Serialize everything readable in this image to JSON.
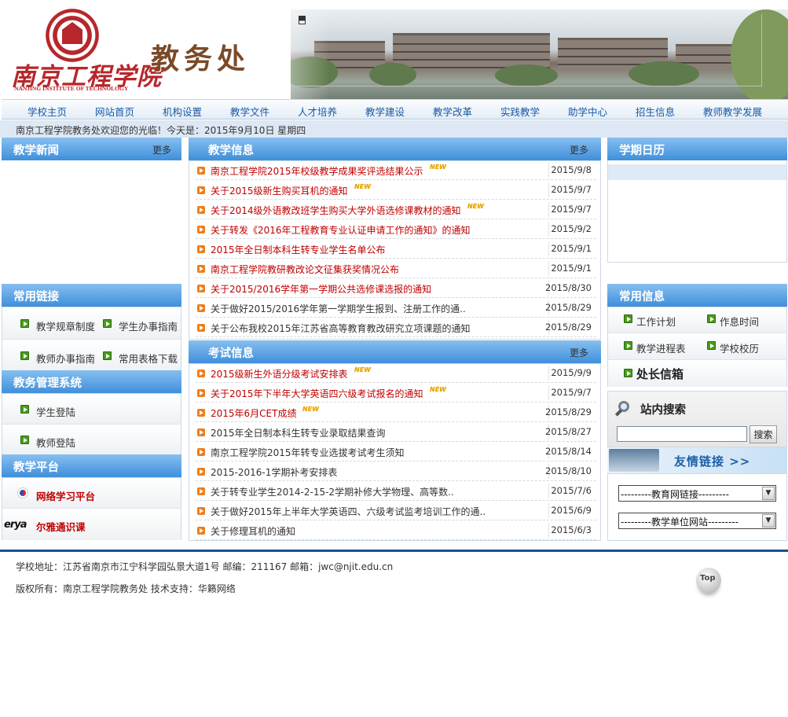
{
  "header": {
    "logo_cn": "南京工程学院",
    "logo_en": "NANJING INSTITUTE OF TECHNOLOGY",
    "banner_title": "教务处"
  },
  "nav": {
    "items": [
      "学校主页",
      "网站首页",
      "机构设置",
      "教学文件",
      "人才培养",
      "教学建设",
      "教学改革",
      "实践教学",
      "助学中心",
      "招生信息",
      "教师教学发展"
    ]
  },
  "welcome": "南京工程学院教务处欢迎您的光临！今天是：2015年9月10日 星期四",
  "left": {
    "news_title": "教学新闻",
    "news_more": "更多",
    "links_title": "常用链接",
    "links": [
      "教学规章制度",
      "学生办事指南",
      "教师办事指南",
      "常用表格下载"
    ],
    "system_title": "教务管理系统",
    "system_links": [
      "学生登陆",
      "教师登陆"
    ],
    "platform_title": "教学平台",
    "platforms": [
      "网络学习平台",
      "尔雅通识课"
    ],
    "erya_logo": "erya"
  },
  "center": {
    "info_title": "教学信息",
    "info_more": "更多",
    "info_items": [
      {
        "title": "南京工程学院2015年校级教学成果奖评选结果公示",
        "date": "2015/9/8",
        "red": true,
        "new": true
      },
      {
        "title": "关于2015级新生购买耳机的通知",
        "date": "2015/9/7",
        "red": true,
        "new": true
      },
      {
        "title": "关于2014级外语教改班学生购买大学外语选修课教材的通知",
        "date": "2015/9/7",
        "red": true,
        "new": true
      },
      {
        "title": "关于转发《2016年工程教育专业认证申请工作的通知》的通知",
        "date": "2015/9/2",
        "red": true,
        "new": false
      },
      {
        "title": "2015年全日制本科生转专业学生名单公布",
        "date": "2015/9/1",
        "red": true,
        "new": false
      },
      {
        "title": "南京工程学院教研教改论文征集获奖情况公布",
        "date": "2015/9/1",
        "red": true,
        "new": false
      },
      {
        "title": "关于2015/2016学年第一学期公共选修课选报的通知",
        "date": "2015/8/30",
        "red": true,
        "new": false
      },
      {
        "title": "关于做好2015/2016学年第一学期学生报到、注册工作的通..",
        "date": "2015/8/29",
        "red": false,
        "new": false
      },
      {
        "title": "关于公布我校2015年江苏省高等教育教改研究立项课题的通知",
        "date": "2015/8/29",
        "red": false,
        "new": false
      }
    ],
    "exam_title": "考试信息",
    "exam_more": "更多",
    "exam_items": [
      {
        "title": "2015级新生外语分级考试安排表",
        "date": "2015/9/9",
        "red": true,
        "new": true
      },
      {
        "title": "关于2015年下半年大学英语四六级考试报名的通知",
        "date": "2015/9/7",
        "red": true,
        "new": true
      },
      {
        "title": "2015年6月CET成绩",
        "date": "2015/8/29",
        "red": true,
        "new": true
      },
      {
        "title": "2015年全日制本科生转专业录取结果查询",
        "date": "2015/8/27",
        "red": false,
        "new": false
      },
      {
        "title": "南京工程学院2015年转专业选拔考试考生须知",
        "date": "2015/8/14",
        "red": false,
        "new": false
      },
      {
        "title": "2015-2016-1学期补考安排表",
        "date": "2015/8/10",
        "red": false,
        "new": false
      },
      {
        "title": "关于转专业学生2014-2-15-2学期补修大学物理、高等数..",
        "date": "2015/7/6",
        "red": false,
        "new": false
      },
      {
        "title": "关于做好2015年上半年大学英语四、六级考试监考培训工作的通..",
        "date": "2015/6/9",
        "red": false,
        "new": false
      },
      {
        "title": "关于修理耳机的通知",
        "date": "2015/6/3",
        "red": false,
        "new": false
      }
    ],
    "new_tag": "NEW"
  },
  "right": {
    "calendar_title": "学期日历",
    "info_title": "常用信息",
    "info_links": [
      "工作计划",
      "作息时间",
      "教学进程表",
      "学校校历"
    ],
    "mailbox": "处长信箱",
    "search_title": "站内搜索",
    "search_button": "搜索",
    "search_value": "",
    "friend_links": "友情链接 >>",
    "select_edu": "---------教育网链接---------",
    "select_units": "---------教学单位网站---------"
  },
  "footer": {
    "address": "学校地址：江苏省南京市江宁科学园弘景大道1号 邮编：211167 邮箱：jwc@njit.edu.cn",
    "copyright": "版权所有：南京工程学院教务处 技术支持：华籁网络",
    "top": "Top"
  }
}
